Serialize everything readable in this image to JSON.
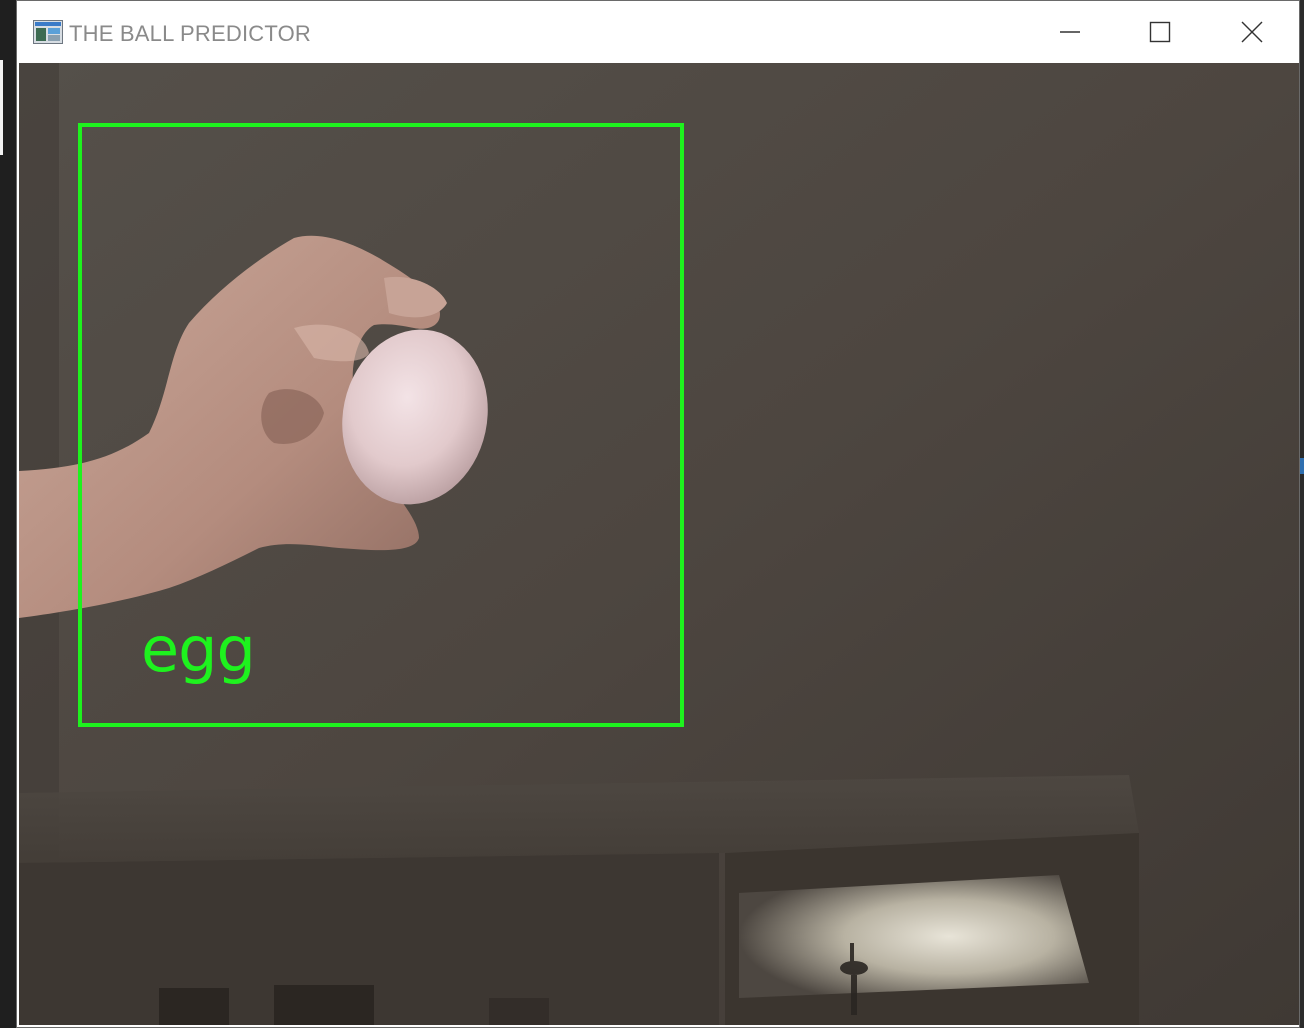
{
  "window": {
    "title": "THE BALL PREDICTOR",
    "icon": "app-window-icon",
    "controls": {
      "minimize_icon": "minimize-icon",
      "maximize_icon": "maximize-icon",
      "close_icon": "close-icon"
    }
  },
  "camera_feed": {
    "detection": {
      "label": "egg",
      "box_color": "#1ef21e"
    }
  }
}
